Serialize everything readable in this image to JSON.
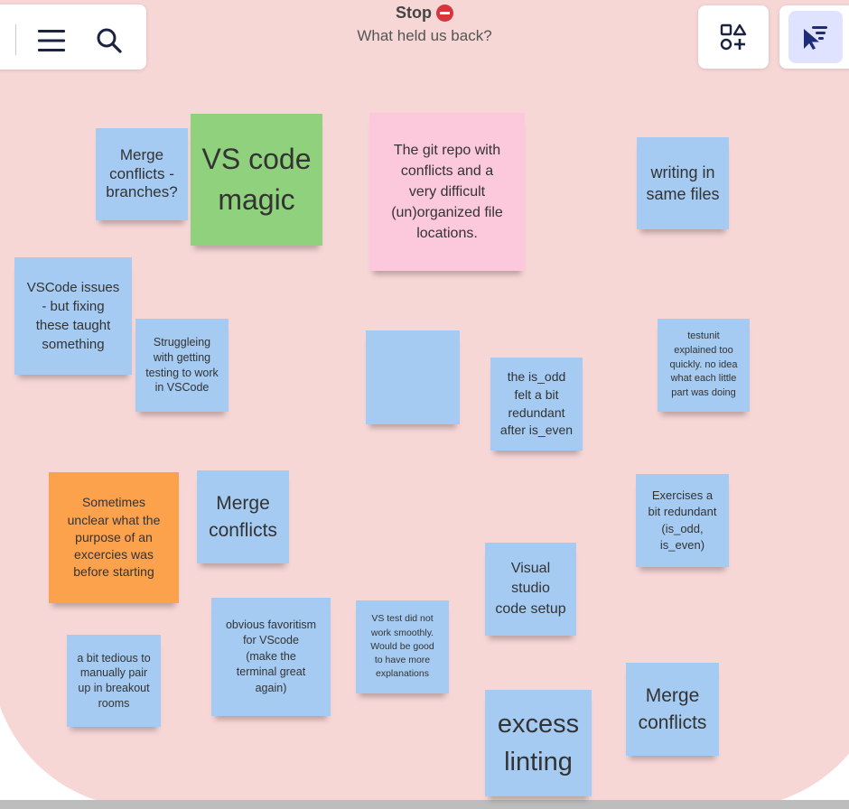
{
  "board": {
    "title": "Stop",
    "subtitle": "What held us back?"
  },
  "toolbar": {
    "icons": [
      "menu-icon",
      "search-icon"
    ]
  },
  "right_toolbar": {
    "icons": [
      "shapes-add-icon",
      "presenter-pointer-icon"
    ],
    "accent_color": "#1f2c7a",
    "active_bg": "#dfe3ff"
  },
  "colors": {
    "board_background": "#f7d6d6",
    "note_blue": "#a5cbf2",
    "note_green": "#8fd17c",
    "note_pink": "#fbc9db",
    "note_orange": "#fca24d",
    "stop_icon": "#d8343b"
  },
  "notes": [
    {
      "text": "Merge\nconflicts -\nbranches?"
    },
    {
      "text": "VS code\nmagic"
    },
    {
      "text": "The git  repo with\nconflicts and a\nvery difficult\n(un)organized file\nlocations."
    },
    {
      "text": "writing in\nsame files"
    },
    {
      "text": "VSCode issues\n- but fixing\nthese taught\nsomething"
    },
    {
      "text": "Struggleing\nwith getting\ntesting to work\nin VSCode"
    },
    {
      "text": ""
    },
    {
      "text": "the is_odd\nfelt a bit\nredundant\nafter is_even"
    },
    {
      "text": "testunit\nexplained too\nquickly. no idea\nwhat each little\npart was doing"
    },
    {
      "text": "Sometimes\nunclear what the\npurpose of an\nexcercies was\nbefore starting"
    },
    {
      "text": "Merge\nconflicts"
    },
    {
      "text": "Exercises a\nbit redundant\n(is_odd,\nis_even)"
    },
    {
      "text": "Visual\nstudio\ncode setup"
    },
    {
      "text": "obvious favoritism\nfor VScode\n(make the\nterminal great\nagain)"
    },
    {
      "text": "VS test did not\nwork smoothly.\nWould be good\nto have more\nexplanations"
    },
    {
      "text": "a bit tedious to\nmanually  pair\nup in breakout\nrooms"
    },
    {
      "text": "Merge\nconflicts"
    },
    {
      "text": "excess\nlinting"
    }
  ]
}
